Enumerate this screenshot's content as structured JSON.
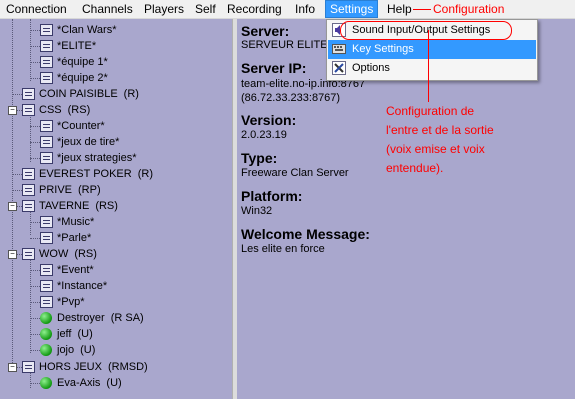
{
  "menubar": {
    "items": [
      "Connection",
      "Channels",
      "Players",
      "Self",
      "Recording",
      "Info",
      "Settings",
      "Help"
    ],
    "active": "Settings"
  },
  "dropdown": {
    "items": [
      {
        "label": "Sound Input/Output Settings",
        "icon": "speaker-icon"
      },
      {
        "label": "Key Settings",
        "icon": "keyboard-icon"
      },
      {
        "label": "Options",
        "icon": "options-icon"
      }
    ],
    "highlighted": "Key Settings"
  },
  "tree": {
    "rows": [
      {
        "type": "channel",
        "name": "*Clan Wars*",
        "meta": ""
      },
      {
        "type": "channel",
        "name": "*ELITE*",
        "meta": ""
      },
      {
        "type": "channel",
        "name": "*équipe 1*",
        "meta": ""
      },
      {
        "type": "channel",
        "name": "*équipe 2*",
        "meta": ""
      },
      {
        "type": "channel",
        "name": "COIN PAISIBLE",
        "meta": "(R)"
      },
      {
        "type": "channel",
        "name": "CSS",
        "meta": "(RS)"
      },
      {
        "type": "channel",
        "name": "*Counter*",
        "meta": ""
      },
      {
        "type": "channel",
        "name": "*jeux de tire*",
        "meta": ""
      },
      {
        "type": "channel",
        "name": "*jeux strategies*",
        "meta": ""
      },
      {
        "type": "channel",
        "name": "EVEREST POKER",
        "meta": "(R)"
      },
      {
        "type": "channel",
        "name": "PRIVE",
        "meta": "(RP)"
      },
      {
        "type": "channel",
        "name": "TAVERNE",
        "meta": "(RS)"
      },
      {
        "type": "channel",
        "name": "*Music*",
        "meta": ""
      },
      {
        "type": "channel",
        "name": "*Parle*",
        "meta": ""
      },
      {
        "type": "channel",
        "name": "WOW",
        "meta": "(RS)"
      },
      {
        "type": "channel",
        "name": "*Event*",
        "meta": ""
      },
      {
        "type": "channel",
        "name": "*Instance*",
        "meta": ""
      },
      {
        "type": "channel",
        "name": "*Pvp*",
        "meta": ""
      },
      {
        "type": "user",
        "name": "Destroyer",
        "meta": "(R SA)"
      },
      {
        "type": "user",
        "name": "jeff",
        "meta": "(U)"
      },
      {
        "type": "user",
        "name": "jojo",
        "meta": "(U)"
      },
      {
        "type": "channel",
        "name": "HORS JEUX",
        "meta": "(RMSD)"
      },
      {
        "type": "user",
        "name": "Eva-Axis",
        "meta": "(U)"
      }
    ]
  },
  "server_info": {
    "server_label": "Server:",
    "server_value": "SERVEUR ELITE",
    "ip_label": "Server IP:",
    "ip_value_1": "team-elite.no-ip.info:8767",
    "ip_value_2": "(86.72.33.233:8767)",
    "version_label": "Version:",
    "version_value": "2.0.23.19",
    "type_label": "Type:",
    "type_value": "Freeware Clan Server",
    "platform_label": "Platform:",
    "platform_value": "Win32",
    "welcome_label": "Welcome Message:",
    "welcome_value": "Les elite en force"
  },
  "annotations": {
    "configuration": "Configuration",
    "note_lines": [
      "Configuration de",
      "l'entre et de la sortie",
      "(voix emise et voix",
      "entendue)."
    ],
    "color": "#ff0000"
  }
}
